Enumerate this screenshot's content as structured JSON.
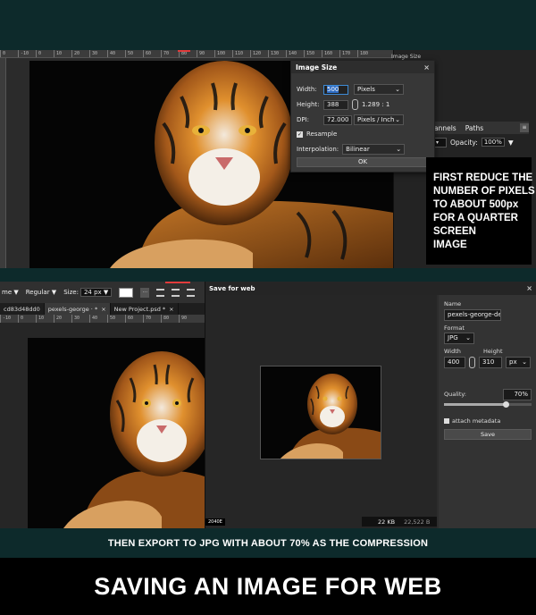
{
  "panel1": {
    "ruler_ticks": [
      "0",
      "-10",
      "0",
      "10",
      "20",
      "30",
      "40",
      "50",
      "60",
      "70",
      "80",
      "90",
      "100",
      "110",
      "120",
      "130",
      "140",
      "150",
      "160",
      "170",
      "180"
    ],
    "image_size_tab": "Image Size",
    "dialog": {
      "title": "Image Size",
      "close": "×",
      "width_label": "Width:",
      "width_value": "500",
      "unit_pixels": "Pixels",
      "height_label": "Height:",
      "height_value": "388",
      "ratio": "1.289 : 1",
      "dpi_label": "DPI:",
      "dpi_value": "72.000",
      "dpi_unit": "Pixels / Inch",
      "resample_label": "Resample",
      "interp_label": "Interpolation:",
      "interp_value": "Bilinear",
      "ok_label": "OK"
    },
    "layers": {
      "tab_channels": "annels",
      "tab_paths": "Paths",
      "close": "≡",
      "opacity_label": "Opacity:",
      "opacity_value": "100%"
    },
    "callout_lines": [
      "FIRST REDUCE THE",
      "NUMBER OF PIXELS",
      "TO ABOUT 500px",
      "FOR A QUARTER",
      "SCREEN",
      " IMAGE"
    ]
  },
  "panel2": {
    "toolbar": {
      "font_name": "me ▼",
      "weight": "Regular ▼",
      "size_label": "Size:",
      "size_value": "24 px ▼",
      "dots": "..."
    },
    "tabs": [
      {
        "label": "cd83d48dd0",
        "close": ""
      },
      {
        "label": "pexels-george · *",
        "close": "×"
      },
      {
        "label": "New Project.psd *",
        "close": "×"
      }
    ],
    "ruler_ticks": [
      "-10",
      "0",
      "10",
      "20",
      "30",
      "40",
      "50",
      "60",
      "70",
      "80",
      "90"
    ],
    "sfw": {
      "title": "Save for web",
      "close": "×",
      "name_label": "Name",
      "name_value": "pexels-george-de",
      "format_label": "Format",
      "format_value": "JPG",
      "width_label": "Width",
      "height_label": "Height",
      "width_value": "400",
      "height_value": "310",
      "unit": "px",
      "quality_label": "Quality:",
      "quality_value": "70%",
      "quality_fraction": 0.7,
      "metadata_label": "attach metadata",
      "save_label": "Save",
      "preview_badge": "2040E",
      "file_size": "22 KB",
      "file_bytes": "22,522 B"
    }
  },
  "caption": "THEN EXPORT TO JPG WITH ABOUT 70% AS THE COMPRESSION",
  "headline": "SAVING AN IMAGE FOR WEB",
  "colors": {
    "teal_band": "#0d2a2b",
    "accent_blue": "#2d6cc4",
    "ruler_red": "#e23b3b"
  }
}
